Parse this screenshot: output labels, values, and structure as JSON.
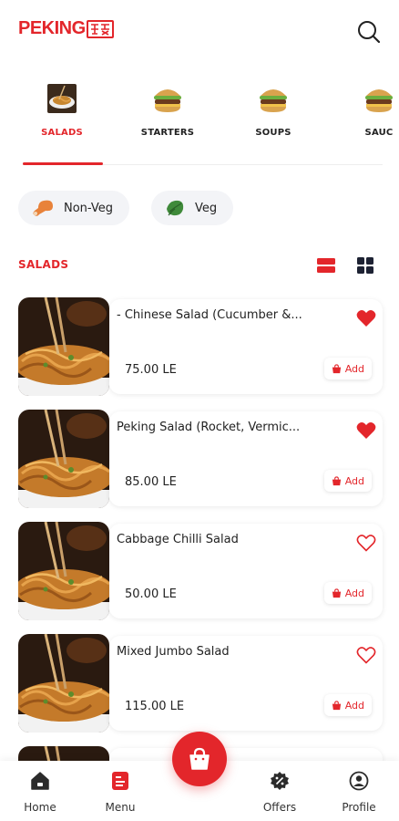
{
  "app": {
    "logo_text": "PEKING"
  },
  "categories": [
    {
      "label": "SALADS",
      "active": true
    },
    {
      "label": "STARTERS",
      "active": false
    },
    {
      "label": "SOUPS",
      "active": false
    },
    {
      "label": "SAUC",
      "active": false
    }
  ],
  "filters": [
    {
      "label": "Non-Veg",
      "icon": "chicken-leg-icon"
    },
    {
      "label": "Veg",
      "icon": "leaf-icon"
    }
  ],
  "section": {
    "title": "SALADS"
  },
  "items": [
    {
      "name": "- Chinese Salad (Cucumber &...",
      "price": "75.00 LE",
      "favorite": true,
      "add_label": "Add"
    },
    {
      "name": "Peking Salad (Rocket, Vermic...",
      "price": "85.00 LE",
      "favorite": true,
      "add_label": "Add"
    },
    {
      "name": "Cabbage Chilli Salad",
      "price": "50.00 LE",
      "favorite": false,
      "add_label": "Add"
    },
    {
      "name": "Mixed Jumbo Salad",
      "price": "115.00 LE",
      "favorite": false,
      "add_label": "Add"
    }
  ],
  "nav": [
    {
      "label": "Home",
      "icon": "home-icon"
    },
    {
      "label": "Menu",
      "icon": "menu-icon"
    },
    {
      "label": "Offers",
      "icon": "offers-icon"
    },
    {
      "label": "Profile",
      "icon": "profile-icon"
    }
  ],
  "colors": {
    "accent": "#e3262b",
    "chip_bg": "#f3f4f7"
  }
}
